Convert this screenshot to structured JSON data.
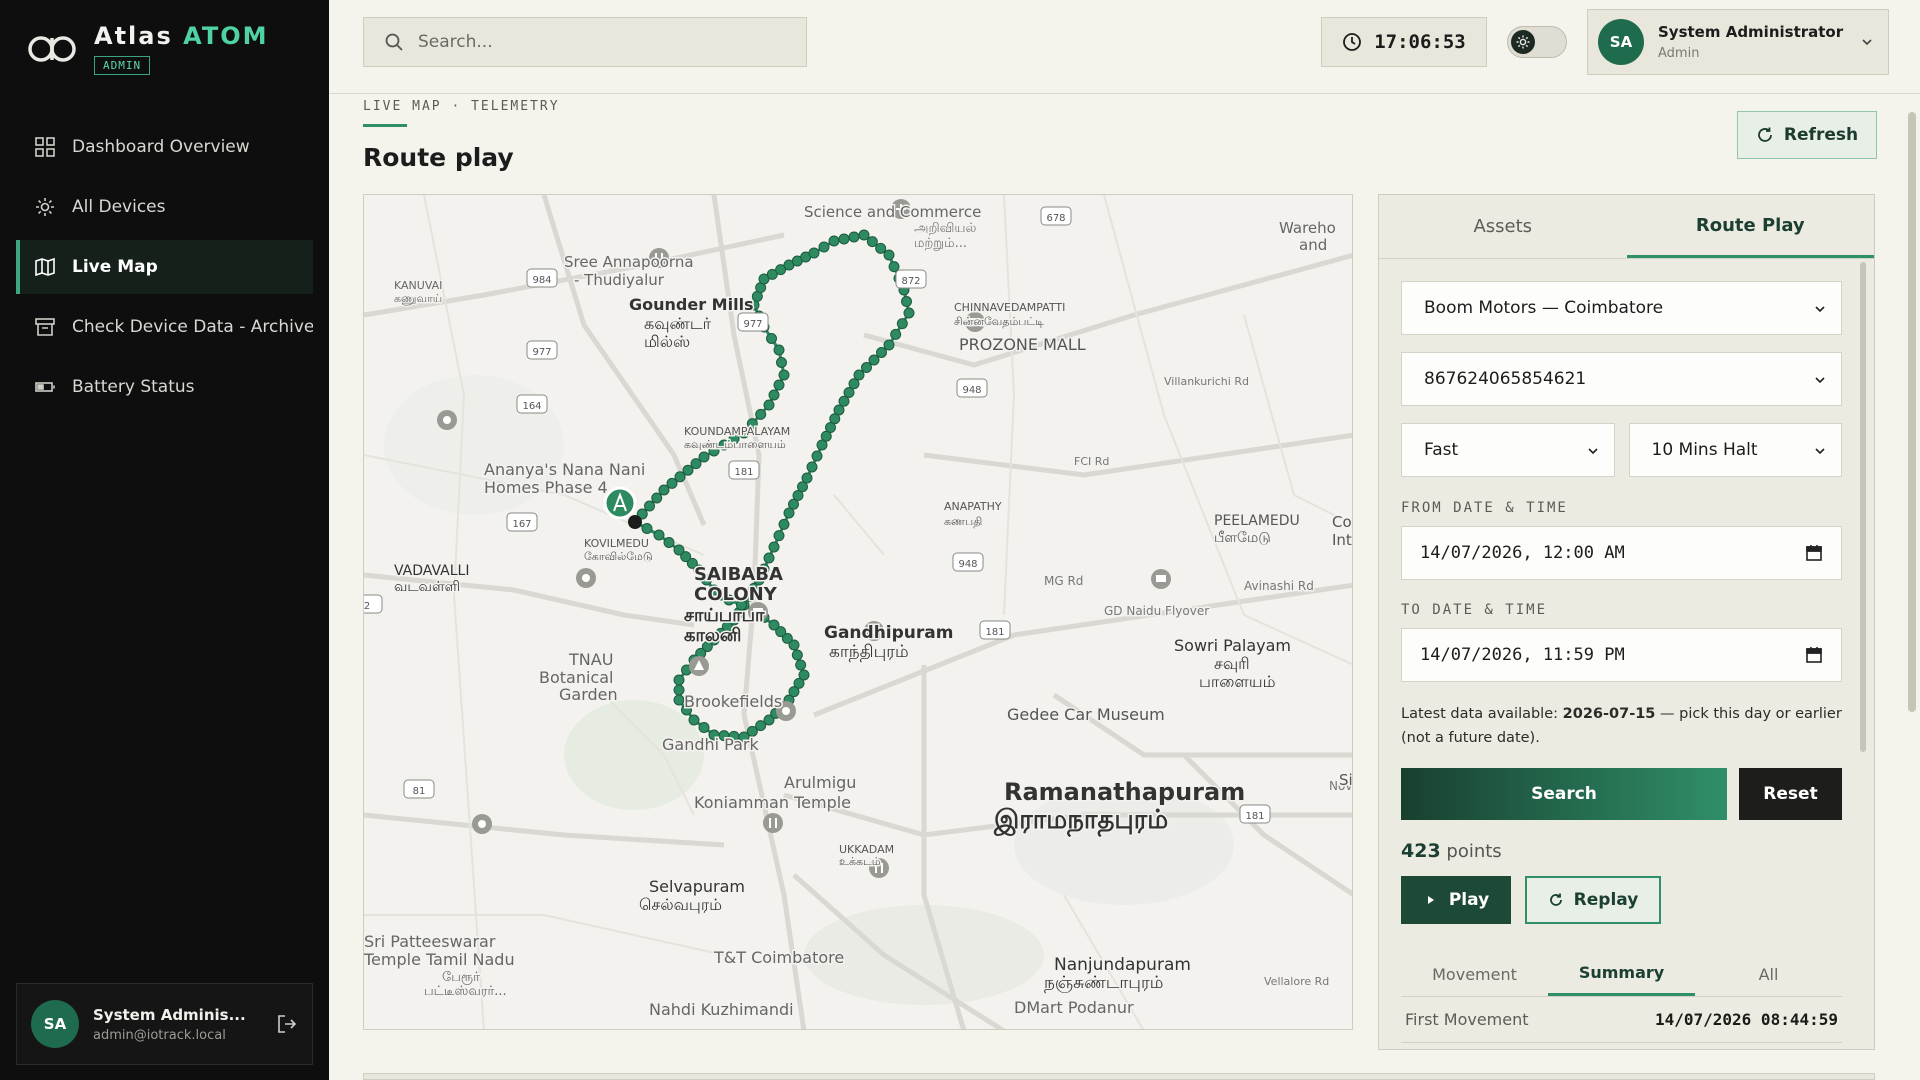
{
  "brand": {
    "name_main": "Atlas",
    "name_accent": "ATOM",
    "badge": "ADMIN"
  },
  "nav": [
    {
      "label": "Dashboard Overview",
      "icon": "grid-icon"
    },
    {
      "label": "All Devices",
      "icon": "gear-icon"
    },
    {
      "label": "Live Map",
      "icon": "map-icon",
      "active": true
    },
    {
      "label": "Check Device Data - Archive",
      "icon": "archive-icon"
    },
    {
      "label": "Battery Status",
      "icon": "battery-icon"
    }
  ],
  "sidebar_user": {
    "initials": "SA",
    "name": "System Adminis...",
    "email": "admin@iotrack.local"
  },
  "topbar": {
    "search_placeholder": "Search...",
    "clock": "17:06:53",
    "user_initials": "SA",
    "user_name": "System Administrator",
    "user_role": "Admin"
  },
  "page": {
    "breadcrumb": "LIVE MAP · TELEMETRY",
    "title": "Route play",
    "refresh_label": "Refresh"
  },
  "map": {
    "labels": [
      "Science and Commerce",
      "அறிவியல்",
      "மற்றும்...",
      "Sree Annapoorna",
      "- Thudiyalur",
      "KANUVAI",
      "கணுவாய்",
      "Gounder Mills",
      "கவுண்டர்",
      "மில்ஸ்",
      "CHINNAVEDAMPATTI",
      "சின்னவேதம்பட்டி",
      "PROZONE MALL",
      "Villankurichi Rd",
      "Wareho",
      "and",
      "KOUNDAMPALAYAM",
      "கவுண்டம்பாளையம்",
      "Ananya's Nana Nani",
      "Homes Phase 4",
      "FCI Rd",
      "KOVILMEDU",
      "கோவில்மேடு",
      "ANAPATHY",
      "கணபதி",
      "PEELAMEDU",
      "பீளமேடு",
      "VADAVALLI",
      "வடவள்ளி",
      "SAIBABA",
      "COLONY",
      "சாய்பாபா",
      "காலனி",
      "MG Rd",
      "Avinashi Rd",
      "GD Naidu Flyover",
      "TNAU",
      "Botanical",
      "Garden",
      "Gandhipuram",
      "காந்திபுரம்",
      "Sowri Palayam",
      "சவுரி",
      "பாளையம்",
      "Brookefields",
      "Gedee Car Museum",
      "Gandhi Park",
      "Ramanathapuram",
      "இராமநாதபுரம்",
      "Arulmigu",
      "Koniamman Temple",
      "UKKADAM",
      "உக்கடம்",
      "Selvapuram",
      "செல்வபுரம்",
      "Sri Patteeswarar",
      "Temple Tamil Nadu",
      "பேரூர்",
      "பட்டீஸ்வரர்...",
      "T&T Coimbatore",
      "Nanjundapuram",
      "நஞ்சுண்டாபுரம்",
      "Nahdi Kuzhimandi",
      "DMart Podanur",
      "Vellalore Rd",
      "Nov",
      "Si",
      "Int",
      "Co"
    ],
    "shields": [
      "678",
      "984",
      "872",
      "977",
      "977",
      "164",
      "948",
      "181",
      "167",
      "948",
      "181",
      "81",
      "181",
      "2"
    ]
  },
  "panel": {
    "tabs": [
      "Assets",
      "Route Play"
    ],
    "company": "Boom Motors — Coimbatore",
    "device": "867624065854621",
    "speed": "Fast",
    "halt": "10 Mins Halt",
    "from_label": "FROM DATE & TIME",
    "from_value": "14/07/2026, 12:00 AM",
    "to_label": "TO DATE & TIME",
    "to_value": "14/07/2026, 11:59 PM",
    "note_prefix": "Latest data available: ",
    "note_date": "2026-07-15",
    "note_suffix": " — pick this day or earlier (not a future date).",
    "search_label": "Search",
    "reset_label": "Reset",
    "points_count": "423",
    "points_label": "points",
    "play_label": "Play",
    "replay_label": "Replay",
    "subtabs": [
      "Movement",
      "Summary",
      "All"
    ],
    "summary_label": "First Movement",
    "summary_value": "14/07/2026 08:44:59"
  },
  "colors": {
    "accent": "#2f8f69",
    "sidebar_bg": "#0e0e0e",
    "route": "#2e8a60"
  }
}
